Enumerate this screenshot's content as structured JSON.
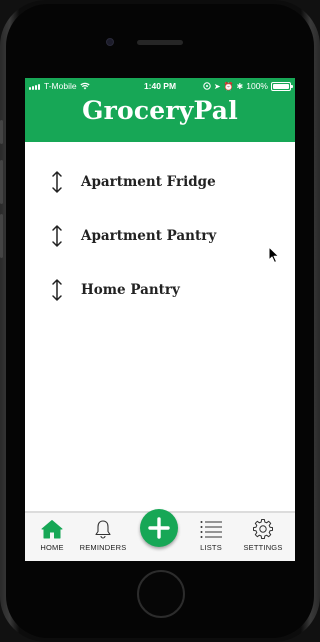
{
  "status_bar": {
    "carrier": "T-Mobile",
    "time": "1:40 PM",
    "battery": "100%",
    "battery_level": 1.0
  },
  "app": {
    "title": "GroceryPal",
    "accent_color": "#17a756"
  },
  "lists": [
    {
      "label": "Apartment Fridge",
      "icon": "reorder-arrows-icon"
    },
    {
      "label": "Apartment Pantry",
      "icon": "reorder-arrows-icon"
    },
    {
      "label": "Home Pantry",
      "icon": "reorder-arrows-icon"
    }
  ],
  "tabbar": {
    "tabs": [
      {
        "label": "HOME",
        "icon": "home-icon",
        "active": true
      },
      {
        "label": "REMINDERS",
        "icon": "bell-icon",
        "active": false
      },
      {
        "label": "LISTS",
        "icon": "list-icon",
        "active": false
      },
      {
        "label": "SETTINGS",
        "icon": "gear-icon",
        "active": false
      }
    ],
    "add_button_icon": "plus-icon"
  }
}
